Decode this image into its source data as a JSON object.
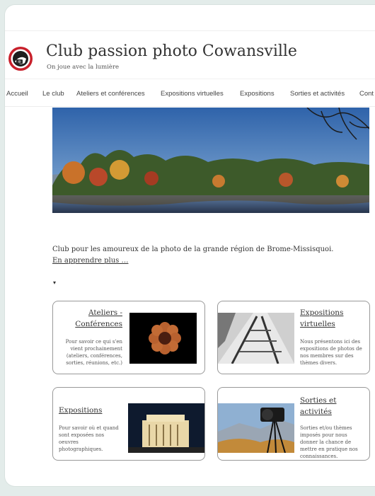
{
  "site": {
    "title": "Club passion photo Cowansville",
    "tagline": "On joue avec la lumière"
  },
  "nav": [
    {
      "label": "Accueil"
    },
    {
      "label": "Le club"
    },
    {
      "label": "Ateliers et conférences"
    },
    {
      "label": "Expositions virtuelles"
    },
    {
      "label": "Expositions"
    },
    {
      "label": "Sorties et activités"
    },
    {
      "label": "Cont"
    }
  ],
  "intro": {
    "text": "Club pour les amoureux de la photo de la grande région de Brome-Missisquoi. ",
    "link": "En apprendre plus …"
  },
  "caret": "▾",
  "features": [
    {
      "title": "Ateliers - Conférences",
      "text": "Pour savoir ce qui s'en vient prochainement (ateliers, conférences, sorties, réunions, etc.)"
    },
    {
      "title": "Expositions virtuelles",
      "text": "Nous présentons ici des expositions de photos de nos membres sur des thèmes divers."
    },
    {
      "title": "Expositions",
      "text": "Pour savoir où et quand sont exposées nos oeuvres photographiques."
    },
    {
      "title": "Sorties et activités",
      "text": "Sorties et/ou thèmes imposés pour nous donner la chance de mettre en pratique nos connaissances."
    }
  ],
  "colors": {
    "page_bg": "#e3ecea",
    "logo_red": "#c8202b",
    "sky": "#3f6fb0"
  },
  "icons": [
    "camera-logo-icon",
    "dropdown-caret-icon"
  ]
}
